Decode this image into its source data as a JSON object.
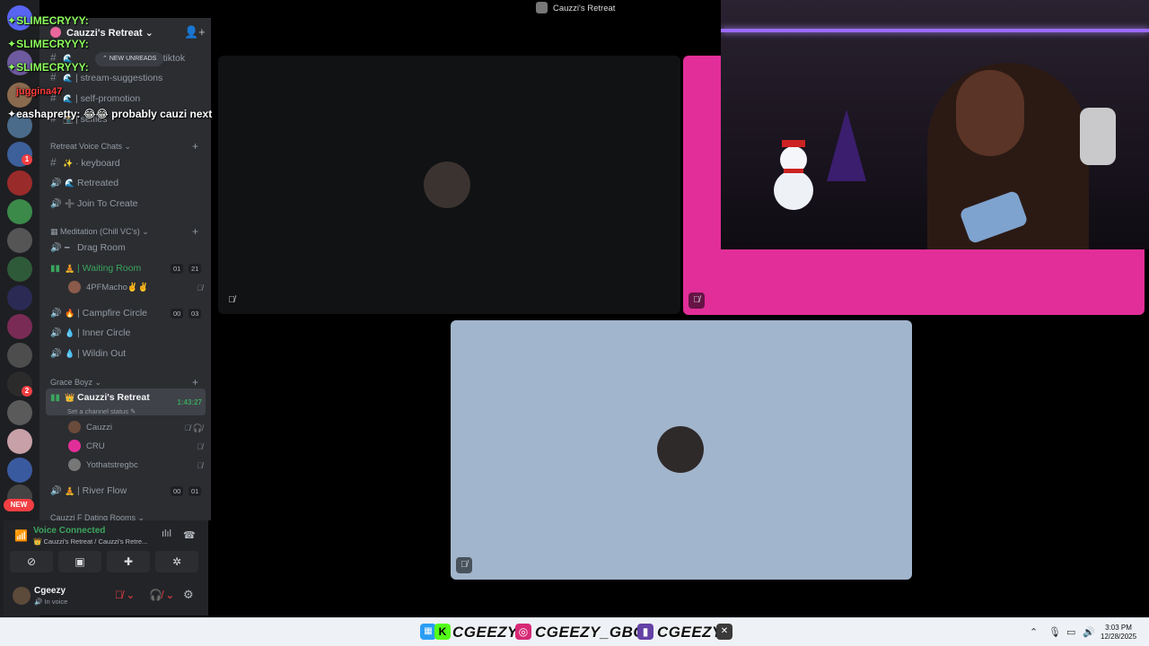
{
  "window": {
    "title": "Cauzzi's Retreat"
  },
  "server": {
    "name": "Cauzzi's Retreat",
    "new_unreads_label": "NEW UNREADS",
    "rail_new_label": "NEW",
    "rail_badges": [
      "1",
      "2"
    ]
  },
  "channels_top": [
    {
      "label": "| tiktok"
    },
    {
      "label": "| stream-suggestions"
    },
    {
      "label": "| self-promotion"
    },
    {
      "label": "| selfies"
    }
  ],
  "categories": {
    "retreat_voice": "Retreat Voice Chats",
    "meditation": "Meditation (Chill VC's)",
    "grace": "Grace Boyz",
    "dating": "Cauzzi F Dating Rooms"
  },
  "retreat_channels": [
    {
      "label": "· keyboard",
      "emoji": "✨"
    },
    {
      "label": "Retreated",
      "emoji": "🌊"
    },
    {
      "label": "Join To Create",
      "emoji": "➕"
    }
  ],
  "meditation_channels": {
    "drag": "Drag Room",
    "waiting": "| Waiting Room",
    "waiting_counts": [
      "01",
      "21"
    ],
    "waiting_user": "4PFMacho✌️✌️",
    "campfire": "| Campfire Circle",
    "campfire_counts": [
      "00",
      "03"
    ],
    "inner": "| Inner Circle",
    "wildin": "| Wildin Out"
  },
  "grace_channels": {
    "current": "Cauzzi's Retreat",
    "timer": "1:43:27",
    "status_placeholder": "Set a channel status",
    "users": [
      "Cauzzi",
      "CRU",
      "Yothatstregbc"
    ],
    "river": "| River Flow",
    "river_counts": [
      "00",
      "01"
    ]
  },
  "voice_panel": {
    "connected": "Voice Connected",
    "location": "Cauzzi's Retreat / Cauzzi's Retre...",
    "user_name": "Cgeezy",
    "user_status": "In voice"
  },
  "chat_overlay": [
    {
      "user": "SLIMECRYYY:",
      "color": "green"
    },
    {
      "user": "SLIMECRYYY:",
      "color": "green"
    },
    {
      "user": "SLIMECRYYY:",
      "color": "green"
    },
    {
      "user": "juggina47",
      "color": "red"
    },
    {
      "user": "eashapretty:",
      "message": "😂😂 probably cauzi next",
      "color": "white"
    }
  ],
  "taskbar": {
    "brands": [
      "CGEEZY",
      "CGEEZY_GBC",
      "CGEEZY"
    ],
    "time": "3:03 PM",
    "date": "12/28/2025"
  },
  "colors": {
    "discord_green": "#3ba55d",
    "tile_pink": "#e22e99",
    "tile_blue": "#a1b5cc",
    "mute_red": "#f23f43"
  }
}
